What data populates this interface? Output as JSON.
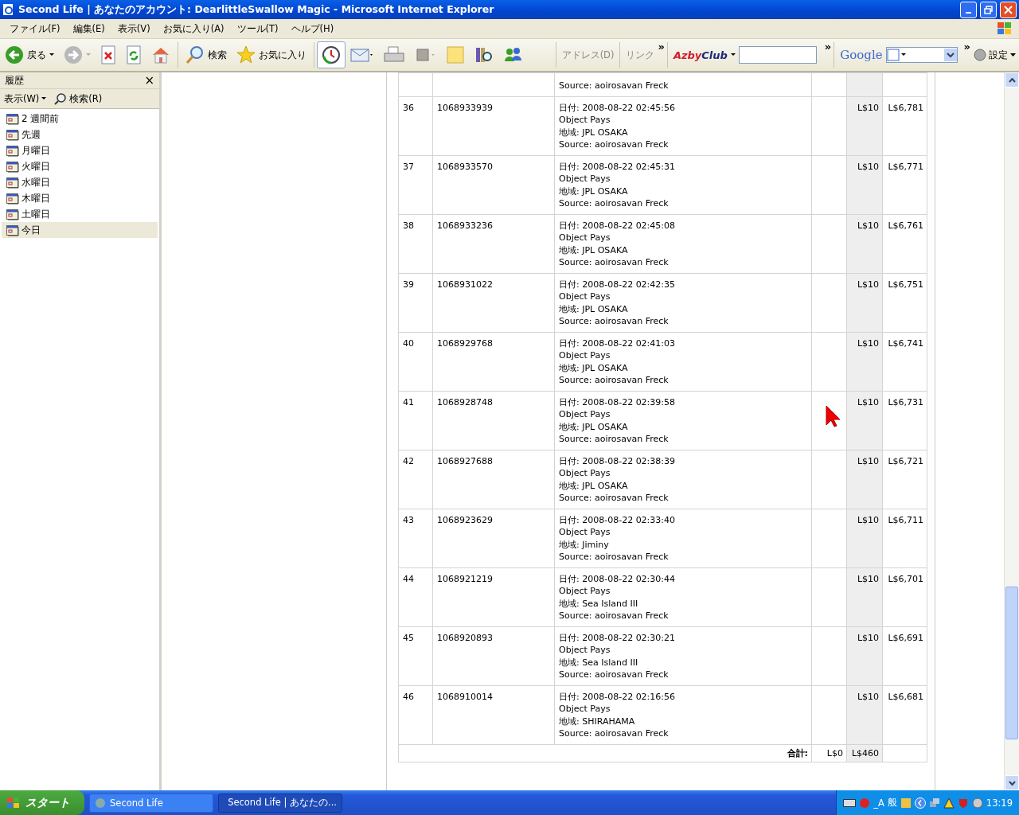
{
  "window": {
    "title": "Second Life | あなたのアカウント: DearlittleSwallow Magic - Microsoft Internet Explorer"
  },
  "menu": [
    "ファイル(F)",
    "編集(E)",
    "表示(V)",
    "お気に入り(A)",
    "ツール(T)",
    "ヘルプ(H)"
  ],
  "toolbar": [
    {
      "kind": "back",
      "label": "戻る",
      "pressed": false
    },
    {
      "kind": "forward",
      "pressed": false
    },
    {
      "kind": "stop",
      "pressed": false
    },
    {
      "kind": "refresh",
      "pressed": false
    },
    {
      "kind": "home",
      "pressed": false
    },
    {
      "kind": "search",
      "label": "検索",
      "pressed": false
    },
    {
      "kind": "favorites",
      "label": "お気に入り",
      "pressed": false
    },
    {
      "kind": "history",
      "pressed": true
    },
    {
      "kind": "mail",
      "pressed": false
    },
    {
      "kind": "print",
      "pressed": false
    },
    {
      "kind": "edit",
      "pressed": false
    },
    {
      "kind": "note",
      "pressed": false
    },
    {
      "kind": "research",
      "pressed": false
    },
    {
      "kind": "messenger",
      "pressed": false
    }
  ],
  "address_bar": {
    "address_label": "アドレス(D)",
    "links_label": "リンク",
    "chevron": "»"
  },
  "azby_bar": {
    "logo_1": "Azby",
    "logo_2": "Club",
    "chevron": "»"
  },
  "google_bar": {
    "logo": "Google",
    "chevron": "»",
    "settings": "設定"
  },
  "sidebar": {
    "title": "履歴",
    "close": "×",
    "view_button": "表示(W)",
    "search_button": "検索(R)",
    "items": [
      {
        "label": "2 週間前",
        "selected": false
      },
      {
        "label": "先週",
        "selected": false
      },
      {
        "label": "月曜日",
        "selected": false
      },
      {
        "label": "火曜日",
        "selected": false
      },
      {
        "label": "水曜日",
        "selected": false
      },
      {
        "label": "木曜日",
        "selected": false
      },
      {
        "label": "土曜日",
        "selected": false
      },
      {
        "label": "今日",
        "selected": true
      }
    ]
  },
  "table": {
    "partial_row": {
      "lines": [
        "Source: aoirosavan Freck"
      ]
    },
    "rows": [
      {
        "number": "36",
        "id": "1068933939",
        "lines": [
          "日付: 2008-08-22 02:45:56",
          "Object Pays",
          "地域: JPL OSAKA",
          "Source: aoirosavan Freck"
        ],
        "credit": "L$10",
        "balance": "L$6,781"
      },
      {
        "number": "37",
        "id": "1068933570",
        "lines": [
          "日付: 2008-08-22 02:45:31",
          "Object Pays",
          "地域: JPL OSAKA",
          "Source: aoirosavan Freck"
        ],
        "credit": "L$10",
        "balance": "L$6,771"
      },
      {
        "number": "38",
        "id": "1068933236",
        "lines": [
          "日付: 2008-08-22 02:45:08",
          "Object Pays",
          "地域: JPL OSAKA",
          "Source: aoirosavan Freck"
        ],
        "credit": "L$10",
        "balance": "L$6,761"
      },
      {
        "number": "39",
        "id": "1068931022",
        "lines": [
          "日付: 2008-08-22 02:42:35",
          "Object Pays",
          "地域: JPL OSAKA",
          "Source: aoirosavan Freck"
        ],
        "credit": "L$10",
        "balance": "L$6,751"
      },
      {
        "number": "40",
        "id": "1068929768",
        "lines": [
          "日付: 2008-08-22 02:41:03",
          "Object Pays",
          "地域: JPL OSAKA",
          "Source: aoirosavan Freck"
        ],
        "credit": "L$10",
        "balance": "L$6,741"
      },
      {
        "number": "41",
        "id": "1068928748",
        "lines": [
          "日付: 2008-08-22 02:39:58",
          "Object Pays",
          "地域: JPL OSAKA",
          "Source: aoirosavan Freck"
        ],
        "credit": "L$10",
        "balance": "L$6,731"
      },
      {
        "number": "42",
        "id": "1068927688",
        "lines": [
          "日付: 2008-08-22 02:38:39",
          "Object Pays",
          "地域: JPL OSAKA",
          "Source: aoirosavan Freck"
        ],
        "credit": "L$10",
        "balance": "L$6,721"
      },
      {
        "number": "43",
        "id": "1068923629",
        "lines": [
          "日付: 2008-08-22 02:33:40",
          "Object Pays",
          "地域: Jiminy",
          "Source: aoirosavan Freck"
        ],
        "credit": "L$10",
        "balance": "L$6,711"
      },
      {
        "number": "44",
        "id": "1068921219",
        "lines": [
          "日付: 2008-08-22 02:30:44",
          "Object Pays",
          "地域: Sea Island III",
          "Source: aoirosavan Freck"
        ],
        "credit": "L$10",
        "balance": "L$6,701"
      },
      {
        "number": "45",
        "id": "1068920893",
        "lines": [
          "日付: 2008-08-22 02:30:21",
          "Object Pays",
          "地域: Sea Island III",
          "Source: aoirosavan Freck"
        ],
        "credit": "L$10",
        "balance": "L$6,691"
      },
      {
        "number": "46",
        "id": "1068910014",
        "lines": [
          "日付: 2008-08-22 02:16:56",
          "Object Pays",
          "地域: SHIRAHAMA",
          "Source: aoirosavan Freck"
        ],
        "credit": "L$10",
        "balance": "L$6,681"
      }
    ],
    "total": {
      "label": "合計:",
      "debit": "L$0",
      "credit": "L$460"
    }
  },
  "taskbar": {
    "start": "スタート",
    "buttons": [
      {
        "label": "Second Life",
        "selected": false
      },
      {
        "label": "Second Life | あなたの...",
        "selected": true
      }
    ],
    "tray": {
      "ime_1": "_A",
      "ime_2": "般",
      "clock": "13:19"
    }
  }
}
